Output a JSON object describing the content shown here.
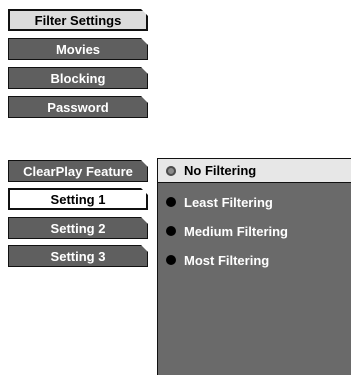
{
  "left_menu": {
    "items": [
      {
        "label": "Filter Settings"
      },
      {
        "label": "Movies"
      },
      {
        "label": "Blocking"
      },
      {
        "label": "Password"
      }
    ]
  },
  "clearplay": {
    "feature_label": "ClearPlay Feature",
    "settings": [
      {
        "label": "Setting 1"
      },
      {
        "label": "Setting 2"
      },
      {
        "label": "Setting 3"
      }
    ]
  },
  "filter_options": [
    {
      "label": "No Filtering",
      "selected": true
    },
    {
      "label": "Least Filtering",
      "selected": false
    },
    {
      "label": "Medium Filtering",
      "selected": false
    },
    {
      "label": "Most Filtering",
      "selected": false
    }
  ],
  "colors": {
    "light_tab": "#dcdcdc",
    "dark_tab": "#5f5f5f",
    "panel": "#6a6a6a",
    "selected_row": "#e7e7e7"
  }
}
